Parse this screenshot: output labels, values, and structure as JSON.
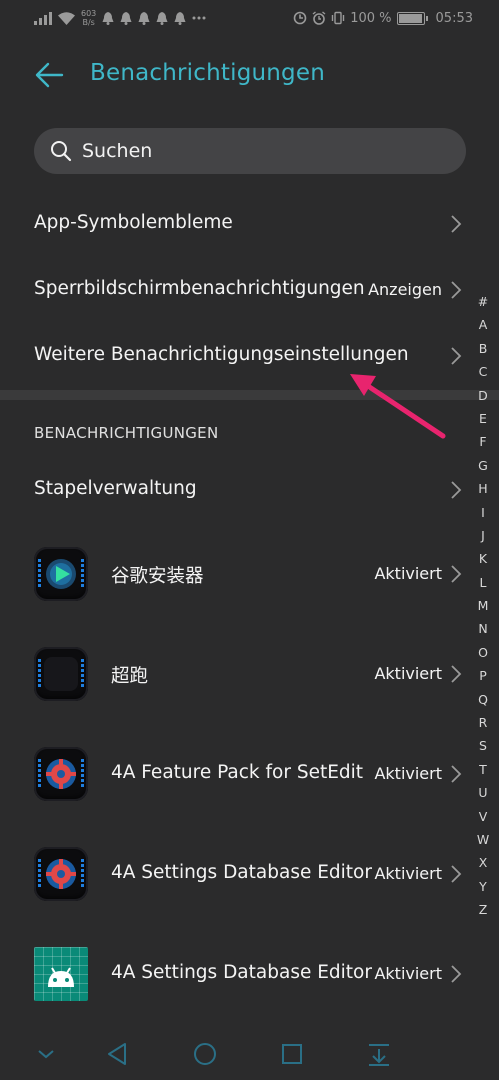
{
  "status_bar": {
    "net_speed_value": "603",
    "net_speed_unit": "B/s",
    "battery": "100 %",
    "time": "05:53",
    "battery_level": 1.0
  },
  "header": {
    "title": "Benachrichtigungen"
  },
  "search": {
    "placeholder": "Suchen"
  },
  "settings": [
    {
      "label": "App-Symbolembleme",
      "value": ""
    },
    {
      "label": "Sperrbildschirmbenachrichtigungen",
      "value": "Anzeigen"
    },
    {
      "label": "Weitere Benachrichtigungseinstellungen",
      "value": ""
    }
  ],
  "section": {
    "title": "BENACHRICHTIGUNGEN",
    "batch_label": "Stapelverwaltung"
  },
  "apps": [
    {
      "name": "谷歌安装器",
      "status": "Aktiviert",
      "icon": "google-installer-icon"
    },
    {
      "name": "超跑",
      "status": "Aktiviert",
      "icon": "dark-app-icon"
    },
    {
      "name": "4A Feature Pack for SetEdit",
      "status": "Aktiviert",
      "icon": "gear-app-icon"
    },
    {
      "name": "4A Settings Database Editor",
      "status": "Aktiviert",
      "icon": "gear-app-icon"
    },
    {
      "name": "4A Settings Database Editor",
      "status": "Aktiviert",
      "icon": "android-icon"
    }
  ],
  "alphabet_index": [
    "#",
    "A",
    "B",
    "C",
    "D",
    "E",
    "F",
    "G",
    "H",
    "I",
    "J",
    "K",
    "L",
    "M",
    "N",
    "O",
    "P",
    "Q",
    "R",
    "S",
    "T",
    "U",
    "V",
    "W",
    "X",
    "Y",
    "Z"
  ],
  "colors": {
    "background": "#2b2b2c",
    "accent": "#3fb7c8",
    "annotation": "#e8246e",
    "search_bg": "#444446"
  }
}
